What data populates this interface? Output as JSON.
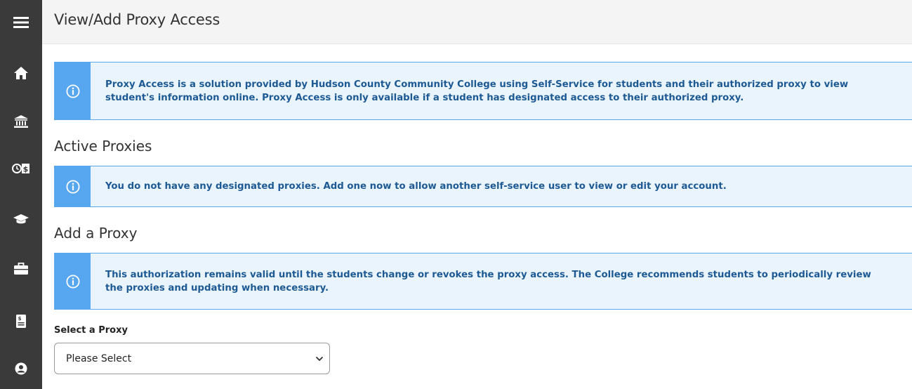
{
  "page": {
    "title": "View/Add Proxy Access"
  },
  "sidebar": {
    "items": [
      {
        "icon": "menu-icon"
      },
      {
        "icon": "home-icon"
      },
      {
        "icon": "institution-icon"
      },
      {
        "icon": "finance-icon"
      },
      {
        "icon": "graduation-cap-icon"
      },
      {
        "icon": "briefcase-icon"
      },
      {
        "icon": "ledger-icon"
      },
      {
        "icon": "user-circle-icon"
      }
    ],
    "background": "#3a3a3a"
  },
  "alerts": {
    "intro": "Proxy Access is a solution provided by Hudson County Community College using Self-Service for students and their authorized proxy to view student's information online. Proxy Access is only available if a student has designated access to their authorized proxy.",
    "no_proxies": "You do not have any designated proxies. Add one now to allow another self-service user to view or edit your account.",
    "authorization": "This authorization remains valid until the students change or revokes the proxy access. The College recommends students to periodically review the proxies and updating when necessary."
  },
  "sections": {
    "active_proxies": "Active Proxies",
    "add_proxy": "Add a Proxy"
  },
  "form": {
    "select_label": "Select a Proxy",
    "select_value": "Please Select"
  },
  "colors": {
    "info_accent": "#56a7f0",
    "info_background": "#eaf4fd",
    "info_text": "#1d5a94"
  }
}
